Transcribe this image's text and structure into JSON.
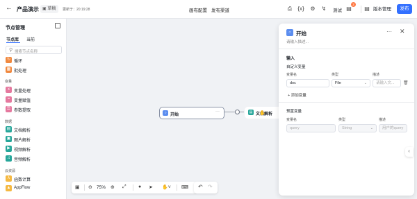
{
  "header": {
    "back_icon": "arrow-left-icon",
    "title": "产品演示",
    "draft_label": "草稿",
    "updated_text": "更新于：20:19:28",
    "tabs": [
      "画布配置",
      "发布渠道"
    ],
    "test_label": "测试",
    "badge_count": "2",
    "version_label": "版本管理",
    "publish_label": "发布"
  },
  "left_panel": {
    "title": "节点管理",
    "tabs": [
      "节点库",
      "当前"
    ],
    "search_placeholder": "搜索节点名称",
    "items": [
      {
        "label": "循环",
        "color": "#f0883e"
      },
      {
        "label": "批处理",
        "color": "#f0883e"
      }
    ],
    "categories": [
      {
        "title": "变量",
        "items": [
          {
            "label": "变量处理",
            "color": "#e5789e"
          },
          {
            "label": "变量赋值",
            "color": "#e5789e"
          },
          {
            "label": "参数提取",
            "color": "#e5789e"
          }
        ]
      },
      {
        "title": "数据",
        "items": [
          {
            "label": "文档解析",
            "color": "#26a69a"
          },
          {
            "label": "图片解析",
            "color": "#26a69a"
          },
          {
            "label": "视频解析",
            "color": "#26a69a"
          },
          {
            "label": "音频解析",
            "color": "#26a69a"
          }
        ]
      },
      {
        "title": "云资源",
        "items": [
          {
            "label": "函数计算",
            "color": "#f5b942"
          },
          {
            "label": "AppFlow",
            "color": "#f5b942"
          }
        ]
      }
    ]
  },
  "canvas": {
    "start_node_label": "开始",
    "doc_node_label": "文档解析",
    "zoom": "75%"
  },
  "panel": {
    "title": "开始",
    "description_placeholder": "请输入描述...",
    "input_section": "输入",
    "custom_vars_label": "自定义变量",
    "columns": [
      "变量名",
      "类型",
      "描述"
    ],
    "custom_var": {
      "name": "doc",
      "type": "File",
      "desc_placeholder": "请输入文..."
    },
    "add_var_label": "添加变量",
    "preset_vars_label": "预置变量",
    "preset_var": {
      "name": "query",
      "type": "String",
      "desc": "用户的query"
    }
  }
}
